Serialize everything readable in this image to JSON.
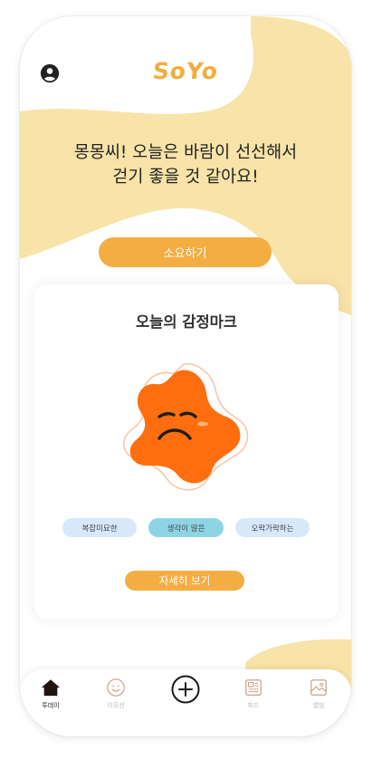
{
  "app": {
    "logo": "SoYo"
  },
  "header": {
    "profile_icon": "user-circle-icon"
  },
  "greeting": {
    "line1": "몽몽씨! 오늘은 바람이 선선해서",
    "line2": "걷기 좋을 것 같아요!"
  },
  "walk_button": {
    "label": "소요하기"
  },
  "emotion_card": {
    "title": "오늘의 감정마크",
    "emotion_icon": "sad-orange-blob-icon",
    "tags": [
      "복잡미묘한",
      "생각이 많은",
      "오락가락하는"
    ],
    "selected_tag": "생각이 많은",
    "detail_button": "자세히 보기"
  },
  "tabs": [
    {
      "label": "투데이",
      "icon": "home-icon",
      "active": true
    },
    {
      "label": "이모션",
      "icon": "smile-icon",
      "active": false
    },
    {
      "label": "",
      "icon": "add-circle-icon",
      "active": false
    },
    {
      "label": "피드",
      "icon": "feed-icon",
      "active": false
    },
    {
      "label": "앨범",
      "icon": "image-icon",
      "active": false
    }
  ],
  "colors": {
    "accent": "#f4ad43",
    "blob": "#f8e3a8",
    "emotion_orange": "#fe6e0f",
    "chip_blue": "#d7e8fb",
    "chip_selected": "#8dd5e4"
  }
}
